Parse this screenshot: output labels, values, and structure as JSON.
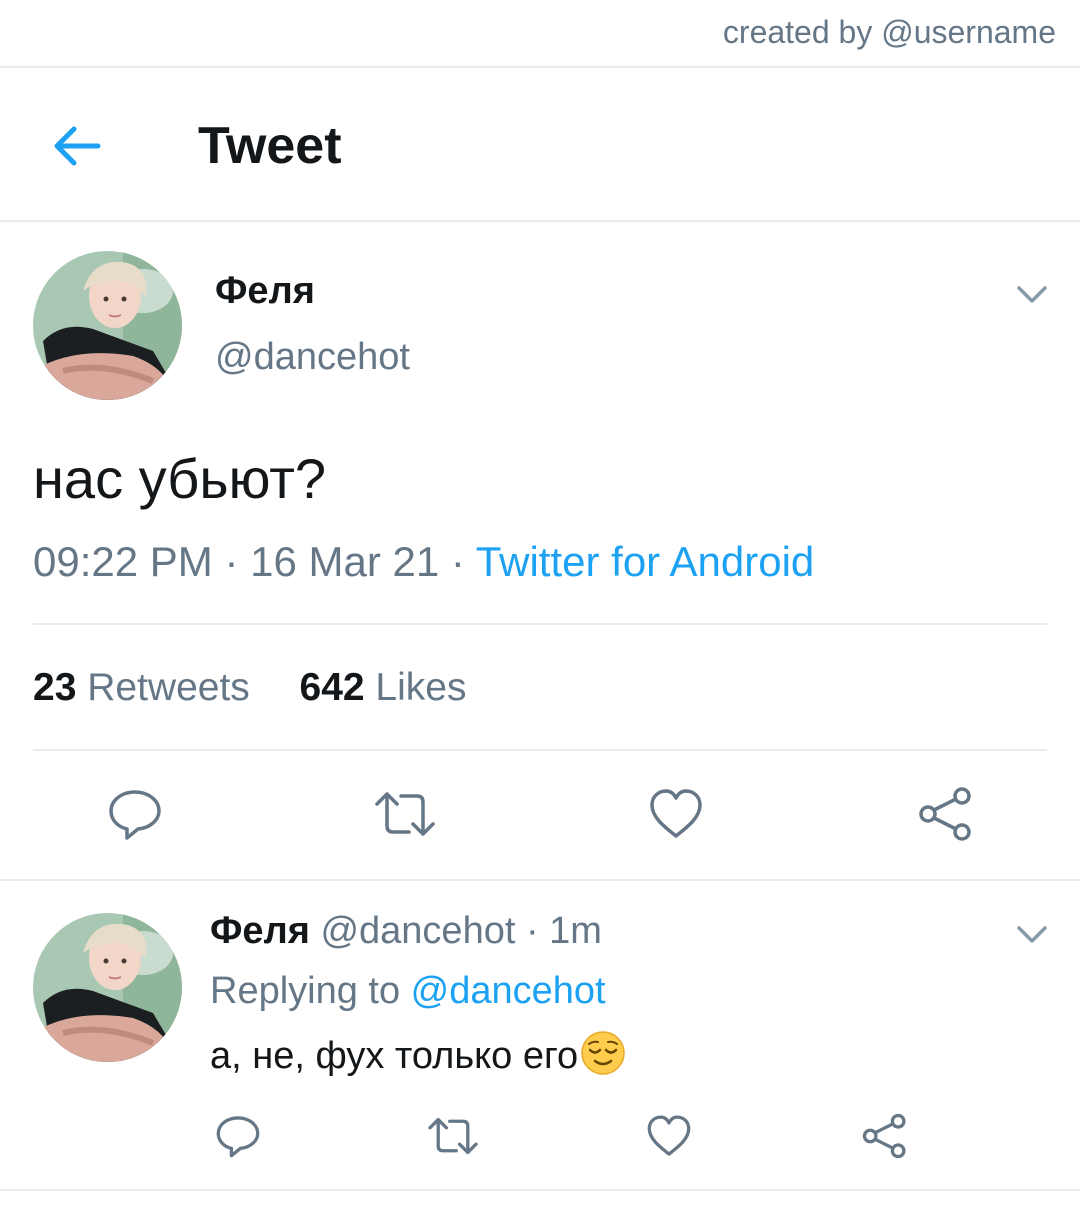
{
  "watermark": "created by @username",
  "header": {
    "title": "Tweet"
  },
  "tweet": {
    "author_name": "Феля",
    "author_handle": "@dancehot",
    "text": "нас убьют?",
    "time": "09:22 PM",
    "sep1": " · ",
    "date": "16 Mar 21",
    "sep2": " · ",
    "source": "Twitter for Android",
    "retweets_count": "23",
    "retweets_label": "Retweets",
    "likes_count": "642",
    "likes_label": "Likes"
  },
  "reply": {
    "author_name": "Феля",
    "author_handle": "@dancehot",
    "sep": " · ",
    "age": "1m",
    "replying_prefix": "Replying to ",
    "replying_to": "@dancehot",
    "text": "а, не, фух только его"
  },
  "icons": {
    "back": "arrow-left-icon",
    "caret": "chevron-down-icon",
    "reply": "comment-icon",
    "retweet": "retweet-icon",
    "like": "heart-icon",
    "share": "share-icon",
    "emoji": "relieved-face-emoji"
  },
  "colors": {
    "accent": "#1da1f2",
    "secondary_text": "#657786",
    "primary_text": "#14171a",
    "divider": "#e6ecf0"
  }
}
